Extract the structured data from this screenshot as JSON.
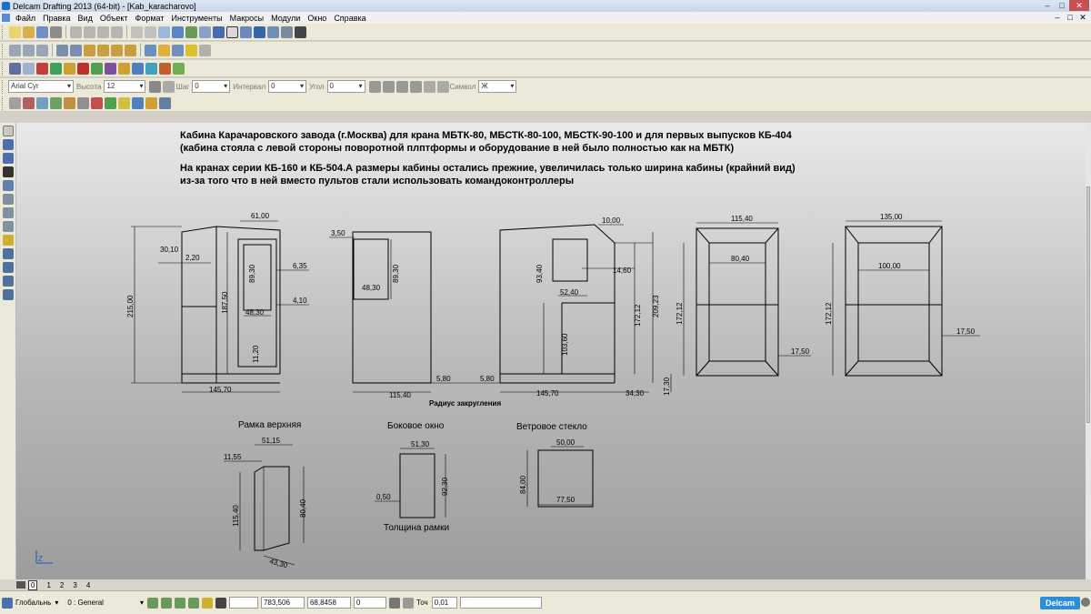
{
  "window": {
    "title": "Delcam Drafting 2013 (64-bit) - [Kab_karacharovo]",
    "minimize": "–",
    "maximize": "□",
    "close": "✕"
  },
  "menu": {
    "items": [
      "Файл",
      "Правка",
      "Вид",
      "Объект",
      "Формат",
      "Инструменты",
      "Макросы",
      "Модули",
      "Окно",
      "Справка"
    ]
  },
  "text_toolbar": {
    "font": "Arial Cyr",
    "height_label": "Высота",
    "height_value": "12",
    "step_label": "Шаг",
    "step_value": "0",
    "interval_label": "Интервал",
    "interval_value": "0",
    "angle_label": "Угол",
    "angle_value": "0",
    "symbol_label": "Символ",
    "symbol_value": "Ж"
  },
  "drawing": {
    "heading1_line1": "Кабина Карачаровского завода (г.Москва) для крана МБТК-80, МБСТК-80-100, МБСТК-90-100 и для первых выпусков КБ-404",
    "heading1_line2": "(кабина стояла с левой стороны поворотной плптформы и оборудование в ней было полностью как на МБТК)",
    "heading2_line1": "На кранах серии КБ-160 и КБ-504.А размеры кабины остались прежние, увеличилась только ширина кабины (крайний вид)",
    "heading2_line2": "из-за того что в ней вместо пультов стали использовать командоконтроллеры",
    "captions": {
      "top_frame": "Рамка верхняя",
      "side_window": "Боковое окно",
      "windshield": "Ветровое стекло",
      "frame_thickness": "Толщина рамки",
      "fillet_radius": "Радиус закругления"
    },
    "dims": {
      "v1_total_h": "215,00",
      "v1_top_w": "61,00",
      "v1_a": "30,10",
      "v1_b": "2,20",
      "v1_win_h": "89,30",
      "v1_c": "6,35",
      "v1_d": "4,10",
      "v1_door_h": "187,50",
      "v1_win_w": "48,30",
      "v1_e": "11,20",
      "v1_base_w": "145,70",
      "v2_top": "3,50",
      "v2_win_w": "48,30",
      "v2_win_h": "89,30",
      "v2_r": "5,80",
      "v2_base": "115,40",
      "v3_top": "10,00",
      "v3_win_h": "93,40",
      "v3_a": "14,60",
      "v3_win_w": "52,40",
      "v3_h1": "172,12",
      "v3_h2": "209,23",
      "v3_door_h": "103,60",
      "v3_r": "5,80",
      "v3_base": "145,70",
      "v3_overhang": "34,30",
      "v3_foot": "17,30",
      "v4_outer_w": "115,40",
      "v4_inner_w": "80,40",
      "v4_h": "172,12",
      "v4_foot": "17,50",
      "v5_outer_w": "135,00",
      "v5_inner_w": "100,00",
      "v5_h": "172,12",
      "v5_foot": "17,50",
      "tf_top_w": "51,15",
      "tf_a": "11,55",
      "tf_h1": "115,40",
      "tf_h2": "80,40",
      "tf_bottom": "43,30",
      "sw_w": "51,30",
      "sw_h": "92,30",
      "sw_t": "0,50",
      "ws_top": "50,00",
      "ws_h": "84,00",
      "ws_bottom": "77,50"
    }
  },
  "tabs": [
    "0",
    "1",
    "2",
    "3",
    "4"
  ],
  "status": {
    "view": "Глобальнь",
    "layer": "0 : General",
    "x": "783,506",
    "y": "68,8458",
    "z": "0",
    "tol_label": "Точ",
    "tol_value": "0,01",
    "brand": "Delcam"
  },
  "colors": {
    "line": "#000000",
    "accent": "#2a8fd8"
  }
}
